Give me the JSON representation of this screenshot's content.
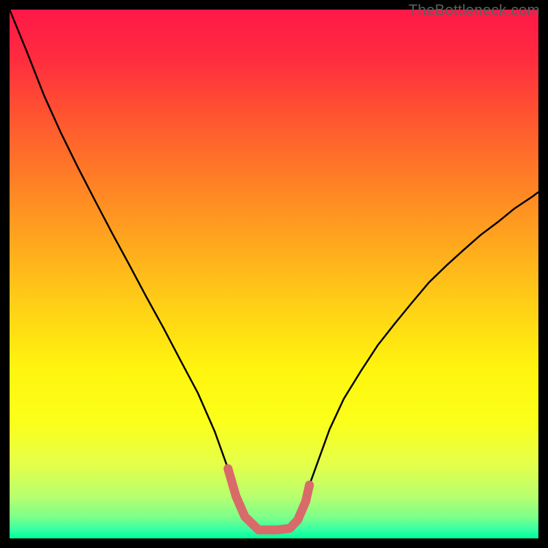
{
  "watermark": "TheBottleneck.com",
  "chart_data": {
    "type": "line",
    "title": "",
    "xlabel": "",
    "ylabel": "",
    "xlim": [
      0,
      100
    ],
    "ylim": [
      0,
      100
    ],
    "series": [
      {
        "name": "bottleneck-curve",
        "x": [
          0,
          3.2,
          6.5,
          9.7,
          12.9,
          16.2,
          19.4,
          22.6,
          25.9,
          29.1,
          32.3,
          35.6,
          38.8,
          41.3,
          44.5,
          47.1,
          50.5,
          54.0,
          56.7,
          60.5,
          63.2,
          66.4,
          69.6,
          72.9,
          76.1,
          79.3,
          82.6,
          85.8,
          89.1,
          92.3,
          95.5,
          98.8,
          100
        ],
        "values": [
          100,
          92.2,
          83.8,
          76.7,
          70.2,
          63.8,
          57.7,
          51.8,
          45.6,
          39.8,
          33.7,
          27.5,
          20.2,
          13.2,
          4.1,
          1.6,
          1.6,
          2.8,
          10.1,
          20.6,
          26.4,
          31.6,
          36.5,
          40.7,
          44.6,
          48.4,
          51.6,
          54.5,
          57.4,
          59.8,
          62.4,
          64.6,
          65.5
        ]
      },
      {
        "name": "optimal-marker",
        "x": [
          41.3,
          42.8,
          44.5,
          47.1,
          50.5,
          53.0,
          54.5,
          56.0,
          56.7
        ],
        "values": [
          13.2,
          8.0,
          4.1,
          1.6,
          1.6,
          1.9,
          3.5,
          7.0,
          10.1
        ]
      }
    ],
    "gradient_stops": [
      {
        "pos": 0.0,
        "color": "#ff1848"
      },
      {
        "pos": 0.09,
        "color": "#ff2b3f"
      },
      {
        "pos": 0.2,
        "color": "#ff5430"
      },
      {
        "pos": 0.32,
        "color": "#ff7e26"
      },
      {
        "pos": 0.44,
        "color": "#ffa71e"
      },
      {
        "pos": 0.56,
        "color": "#ffd016"
      },
      {
        "pos": 0.68,
        "color": "#fff50e"
      },
      {
        "pos": 0.78,
        "color": "#fbff1a"
      },
      {
        "pos": 0.86,
        "color": "#e4ff4a"
      },
      {
        "pos": 0.92,
        "color": "#b8ff6e"
      },
      {
        "pos": 0.96,
        "color": "#7cff8a"
      },
      {
        "pos": 0.985,
        "color": "#30ffa6"
      },
      {
        "pos": 1.0,
        "color": "#00ff99"
      }
    ]
  }
}
